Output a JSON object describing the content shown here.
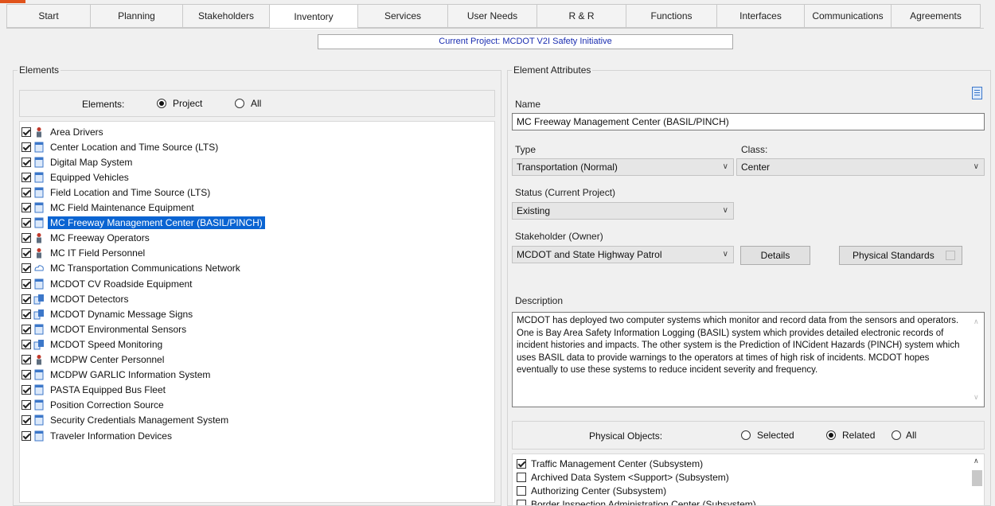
{
  "tabs": [
    {
      "label": "Start",
      "active": false
    },
    {
      "label": "Planning",
      "active": false
    },
    {
      "label": "Stakeholders",
      "active": false
    },
    {
      "label": "Inventory",
      "active": true
    },
    {
      "label": "Services",
      "active": false
    },
    {
      "label": "User Needs",
      "active": false
    },
    {
      "label": "R & R",
      "active": false
    },
    {
      "label": "Functions",
      "active": false
    },
    {
      "label": "Interfaces",
      "active": false
    },
    {
      "label": "Communications",
      "active": false
    },
    {
      "label": "Agreements",
      "active": false
    }
  ],
  "current_project": "Current Project: MCDOT V2I Safety Initiative",
  "elements_panel": {
    "title": "Elements",
    "filter_label": "Elements:",
    "option_project": "Project",
    "option_all": "All",
    "items": [
      {
        "label": "Area Drivers",
        "icon": "person-icon",
        "checked": true,
        "selected": false
      },
      {
        "label": "Center Location and Time Source (LTS)",
        "icon": "center-icon",
        "checked": true,
        "selected": false
      },
      {
        "label": "Digital Map System",
        "icon": "center-icon",
        "checked": true,
        "selected": false
      },
      {
        "label": "Equipped Vehicles",
        "icon": "center-icon",
        "checked": true,
        "selected": false
      },
      {
        "label": "Field Location and Time Source (LTS)",
        "icon": "center-icon",
        "checked": true,
        "selected": false
      },
      {
        "label": "MC Field Maintenance Equipment",
        "icon": "center-icon",
        "checked": true,
        "selected": false
      },
      {
        "label": "MC Freeway Management Center (BASIL/PINCH)",
        "icon": "center-icon",
        "checked": true,
        "selected": true
      },
      {
        "label": "MC Freeway Operators",
        "icon": "person-icon",
        "checked": true,
        "selected": false
      },
      {
        "label": "MC IT Field Personnel",
        "icon": "person-icon",
        "checked": true,
        "selected": false
      },
      {
        "label": "MC Transportation Communications Network",
        "icon": "cloud-icon",
        "checked": true,
        "selected": false
      },
      {
        "label": "MCDOT CV Roadside Equipment",
        "icon": "center-icon",
        "checked": true,
        "selected": false
      },
      {
        "label": "MCDOT Detectors",
        "icon": "field-device-icon",
        "checked": true,
        "selected": false
      },
      {
        "label": "MCDOT Dynamic Message Signs",
        "icon": "field-device-icon",
        "checked": true,
        "selected": false
      },
      {
        "label": "MCDOT Environmental Sensors",
        "icon": "center-icon",
        "checked": true,
        "selected": false
      },
      {
        "label": "MCDOT Speed Monitoring",
        "icon": "field-device-icon",
        "checked": true,
        "selected": false
      },
      {
        "label": "MCDPW Center Personnel",
        "icon": "person-icon",
        "checked": true,
        "selected": false
      },
      {
        "label": "MCDPW GARLIC Information System",
        "icon": "center-icon",
        "checked": true,
        "selected": false
      },
      {
        "label": "PASTA Equipped Bus Fleet",
        "icon": "center-icon",
        "checked": true,
        "selected": false
      },
      {
        "label": "Position Correction Source",
        "icon": "center-icon",
        "checked": true,
        "selected": false
      },
      {
        "label": "Security Credentials Management System",
        "icon": "center-icon",
        "checked": true,
        "selected": false
      },
      {
        "label": "Traveler Information Devices",
        "icon": "center-icon",
        "checked": true,
        "selected": false
      }
    ]
  },
  "attributes_panel": {
    "title": "Element Attributes",
    "name_label": "Name",
    "name_value": "MC Freeway Management Center (BASIL/PINCH)",
    "type_label": "Type",
    "type_value": "Transportation (Normal)",
    "class_label": "Class:",
    "class_value": "Center",
    "status_label": "Status (Current Project)",
    "status_value": "Existing",
    "stakeholder_label": "Stakeholder (Owner)",
    "stakeholder_value": "MCDOT and State Highway Patrol",
    "details_button": "Details",
    "physical_standards_button": "Physical Standards",
    "description_label": "Description",
    "description_text": "MCDOT has deployed two computer systems which monitor and record data from the sensors and operators. One is Bay Area Safety Information Logging (BASIL) system which provides detailed electronic records of incident histories and impacts. The other system is the Prediction of INCident Hazards (PINCH) system which uses BASIL data to provide warnings to the operators at times of high risk of incidents. MCDOT hopes eventually to use these systems to reduce incident severity and frequency.",
    "physical_objects_label": "Physical Objects:",
    "option_selected": "Selected",
    "option_related": "Related",
    "option_all": "All",
    "physical_objects": [
      {
        "label": "Traffic Management Center (Subsystem)",
        "checked": true
      },
      {
        "label": "Archived Data System <Support> (Subsystem)",
        "checked": false
      },
      {
        "label": "Authorizing Center (Subsystem)",
        "checked": false
      },
      {
        "label": "Border Inspection Administration Center (Subsystem)",
        "checked": false
      }
    ]
  },
  "colors": {
    "selection": "#0a64d2",
    "project_text": "#1a2db0",
    "accent": "#e0531c"
  }
}
